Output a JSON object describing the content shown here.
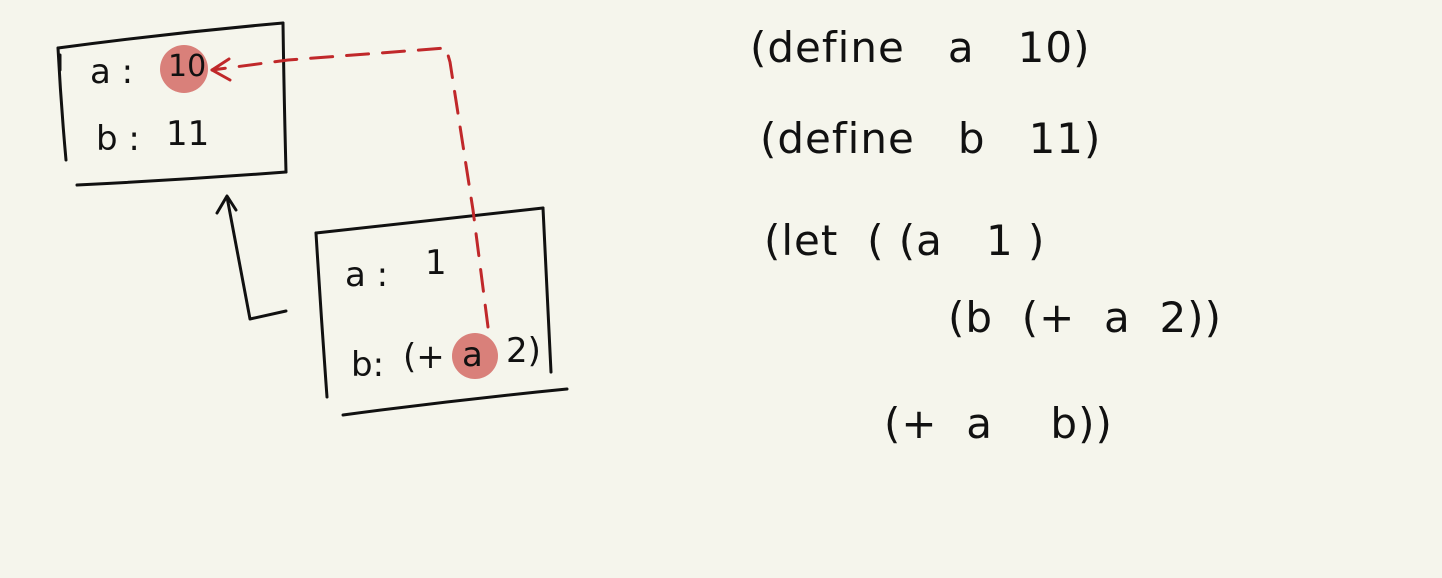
{
  "global_frame": {
    "binding_a": {
      "label": "a :",
      "value": "10"
    },
    "binding_b": {
      "label": "b :",
      "value": "11"
    }
  },
  "let_frame": {
    "binding_a": {
      "label": "a :",
      "value": "1"
    },
    "binding_b": {
      "label": "b:",
      "expr_open": "(+",
      "expr_var": "a",
      "expr_close": "2)"
    }
  },
  "code": {
    "line1": "(define   a   10)",
    "line2": "(define   b   11)",
    "line3": "(let  ( (a   1 )",
    "line4": "(b  (+  a  2))",
    "line5": "(+  a    b))"
  },
  "colors": {
    "background": "#f5f5ec",
    "ink": "#111111",
    "highlight": "#d9807a",
    "lookup_arrow": "#c0282a"
  }
}
